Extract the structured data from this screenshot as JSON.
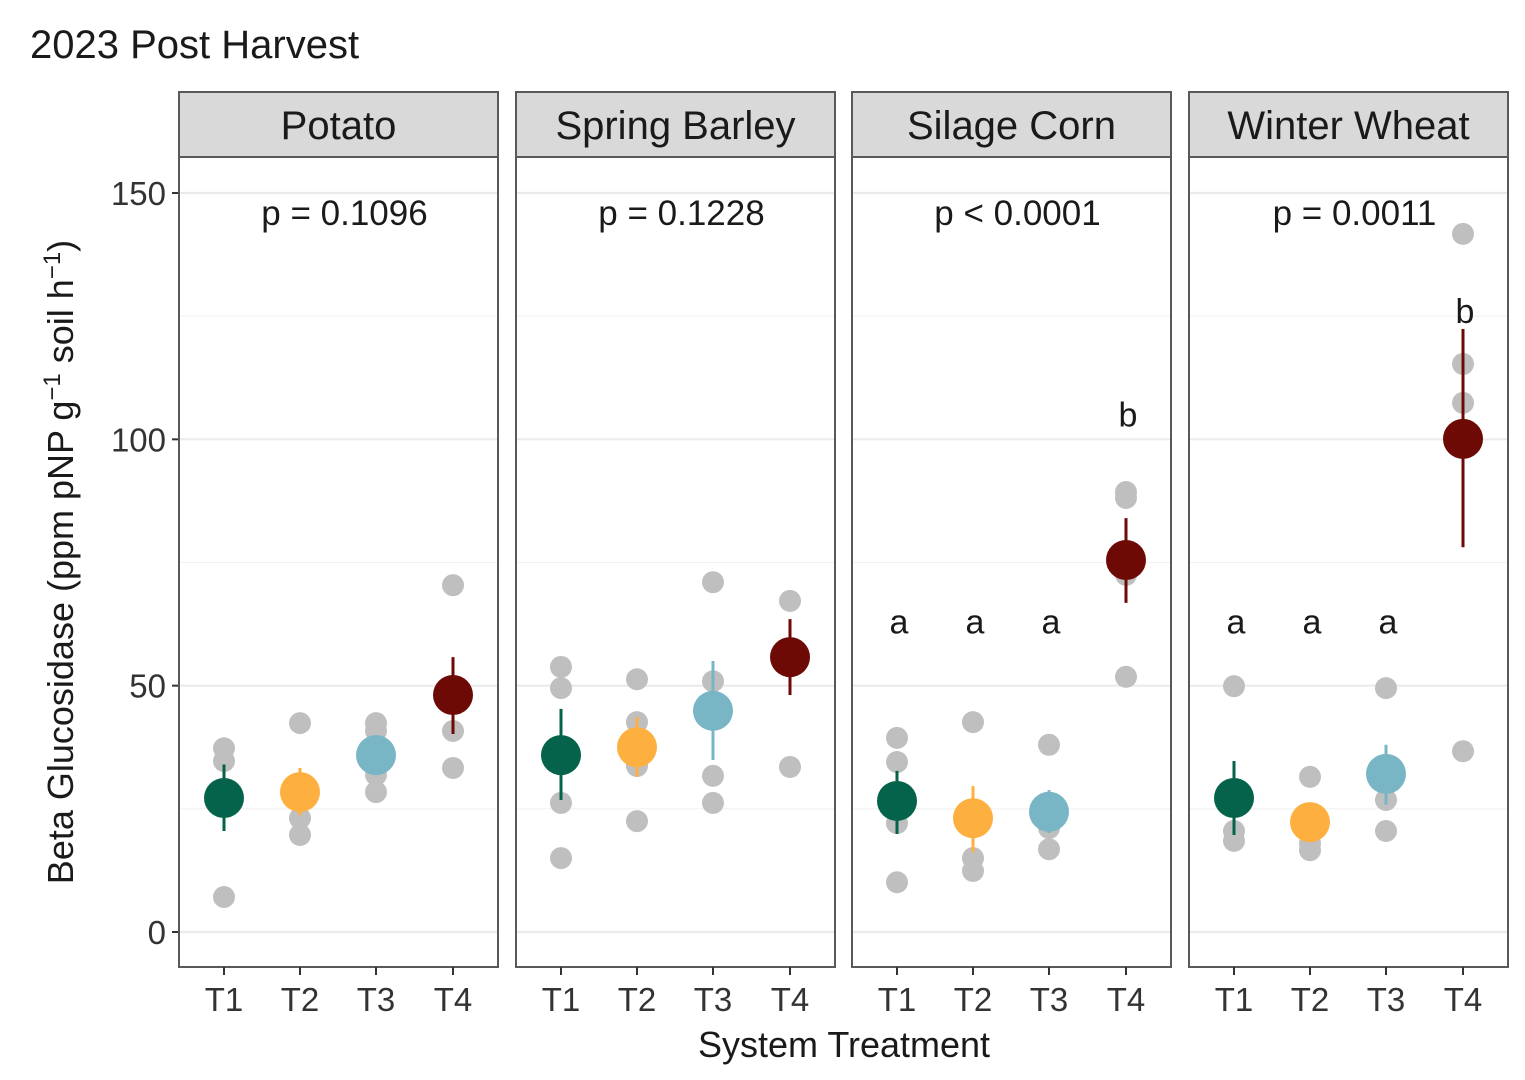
{
  "chart_data": {
    "type": "scatter",
    "title": "2023 Post Harvest",
    "xlabel": "System Treatment",
    "ylabel": "Beta Glucosidase (ppm pNP g⁻¹ soil h⁻¹)",
    "ylabel_parts": {
      "main": "Beta Glucosidase (ppm pNP g",
      "sup1": "−1",
      "mid": " soil h",
      "sup2": "−1",
      "end": ")"
    },
    "ylim": [
      -7,
      157
    ],
    "yticks": [
      0,
      50,
      100,
      150
    ],
    "ytick_labels": [
      "0",
      "50",
      "100",
      "150"
    ],
    "minor_yticks": [
      25,
      75,
      125
    ],
    "grid": true,
    "categories": [
      "T1",
      "T2",
      "T3",
      "T4"
    ],
    "colors": {
      "T1": "#04634a",
      "T2": "#fdb040",
      "T3": "#78b6c6",
      "T4": "#6d0a05",
      "raw": "#bfbfbf",
      "strip_bg": "#d9d9d9",
      "panel_border": "#595959",
      "grid": "#ebebeb"
    },
    "panels": [
      {
        "name": "Potato",
        "p_label": "p = 0.1096",
        "letters": [
          "",
          "",
          "",
          ""
        ],
        "means": [
          27.2,
          28.4,
          35.9,
          48.1
        ],
        "err_low": [
          20.5,
          23.7,
          35.9,
          40.2
        ],
        "err_high": [
          34.0,
          33.3,
          35.9,
          55.8
        ],
        "raw": [
          [
            37.3,
            34.7,
            27.0,
            7.1
          ],
          [
            42.4,
            23.1,
            19.7,
            28.0
          ],
          [
            42.4,
            40.8,
            31.9,
            28.4
          ],
          [
            70.4,
            40.8,
            33.3
          ]
        ]
      },
      {
        "name": "Spring Barley",
        "p_label": "p = 0.1228",
        "letters": [
          "",
          "",
          "",
          ""
        ],
        "means": [
          35.9,
          37.5,
          44.9,
          55.8
        ],
        "err_low": [
          26.8,
          31.5,
          34.9,
          48.1
        ],
        "err_high": [
          45.3,
          43.6,
          55.0,
          63.5
        ],
        "raw": [
          [
            53.8,
            49.5,
            26.2,
            15.0
          ],
          [
            51.3,
            42.6,
            33.7,
            22.5
          ],
          [
            71.0,
            50.9,
            31.7,
            26.2
          ],
          [
            67.2,
            33.5
          ]
        ]
      },
      {
        "name": "Silage Corn",
        "p_label": "p < 0.0001",
        "letters": [
          "a",
          "a",
          "a",
          "b"
        ],
        "means": [
          26.6,
          23.1,
          24.4,
          75.5
        ],
        "err_low": [
          19.9,
          16.2,
          20.1,
          66.8
        ],
        "err_high": [
          32.7,
          29.6,
          28.8,
          84.0
        ],
        "raw": [
          [
            39.4,
            34.5,
            22.1,
            10.1
          ],
          [
            42.6,
            15.0,
            12.4
          ],
          [
            38.0,
            21.1,
            16.8
          ],
          [
            89.3,
            88.1,
            72.5,
            51.8
          ]
        ]
      },
      {
        "name": "Winter Wheat",
        "p_label": "p = 0.0011",
        "letters": [
          "a",
          "a",
          "a",
          "b"
        ],
        "means": [
          27.2,
          22.3,
          32.1,
          100.1
        ],
        "err_low": [
          19.7,
          22.3,
          25.8,
          78.1
        ],
        "err_high": [
          34.7,
          22.3,
          38.0,
          122.4
        ],
        "raw": [
          [
            49.9,
            20.5,
            18.5
          ],
          [
            31.5,
            16.6,
            18.0
          ],
          [
            49.5,
            26.8,
            20.5
          ],
          [
            141.7,
            115.3,
            107.4,
            36.7
          ]
        ]
      }
    ],
    "letter_y": [
      [
        null,
        null,
        null,
        null
      ],
      [
        null,
        null,
        null,
        null
      ],
      [
        63,
        63,
        63,
        105
      ],
      [
        63,
        63,
        63,
        126
      ]
    ],
    "p_label_y": 148
  }
}
